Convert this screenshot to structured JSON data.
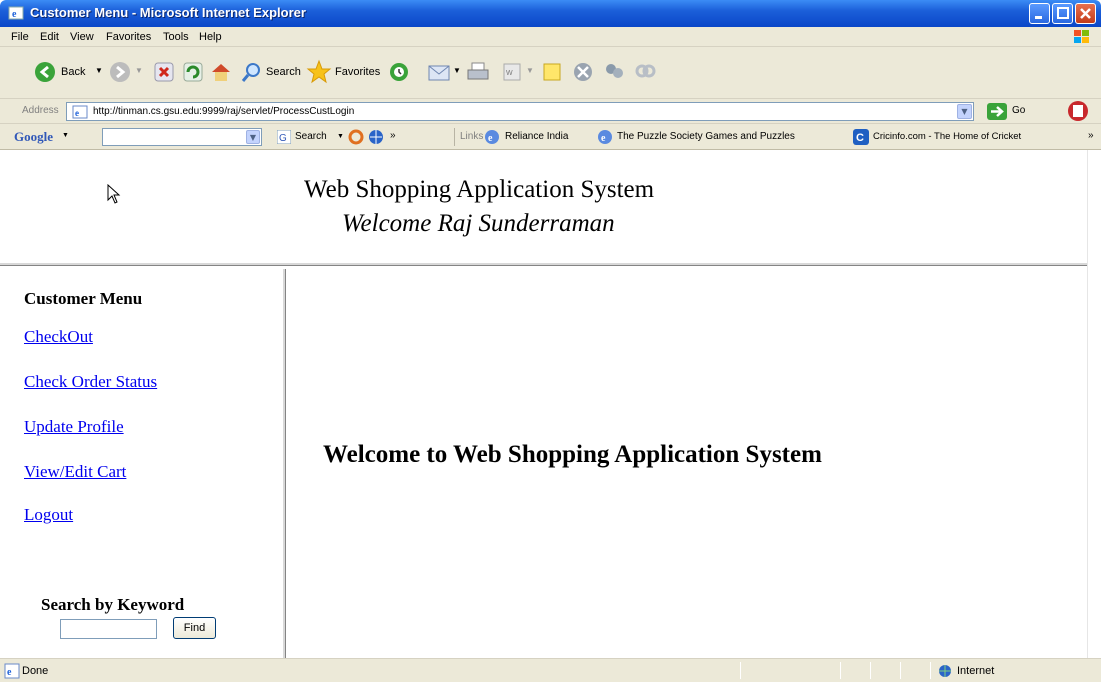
{
  "window": {
    "title": "Customer Menu - Microsoft Internet Explorer"
  },
  "menubar": {
    "items": [
      "File",
      "Edit",
      "View",
      "Favorites",
      "Tools",
      "Help"
    ]
  },
  "toolbar": {
    "back_label": "Back",
    "search_label": "Search",
    "favorites_label": "Favorites"
  },
  "addressbar": {
    "label": "Address",
    "url": "http://tinman.cs.gsu.edu:9999/raj/servlet/ProcessCustLogin",
    "go_label": "Go"
  },
  "googlebar": {
    "brand": "Google",
    "search_label": "Search",
    "more": "»",
    "links_label": "Links",
    "links": [
      "Reliance India",
      "The Puzzle Society Games and Puzzles",
      "Cricinfo.com - The Home of Cricket"
    ],
    "links_more": "»"
  },
  "page": {
    "heading": "Web Shopping Application System",
    "welcome_user": "Welcome Raj Sunderraman",
    "sidebar": {
      "title": "Customer Menu",
      "links": [
        "CheckOut",
        "Check Order Status",
        "Update Profile",
        "View/Edit Cart",
        "Logout"
      ],
      "search_title": "Search by Keyword",
      "search_value": "",
      "find_label": "Find"
    },
    "main_message": "Welcome to Web Shopping Application System"
  },
  "statusbar": {
    "status": "Done",
    "zone": "Internet"
  }
}
